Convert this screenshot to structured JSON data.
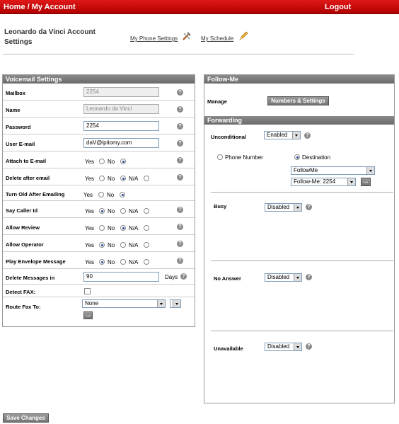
{
  "topbar": {
    "home": "Home / My Account",
    "logout": "Logout"
  },
  "header": {
    "title": "Leonardo da Vinci Account Settings",
    "phone_link": "My Phone Settings",
    "schedule_link": "My Schedule"
  },
  "voicemail": {
    "title": "Voicemail Settings",
    "mailbox": {
      "label": "Mailbox",
      "value": "2254"
    },
    "name": {
      "label": "Name",
      "value": "Leonardo da Vinci"
    },
    "password": {
      "label": "Password",
      "value": "2254"
    },
    "email": {
      "label": "User E-mail",
      "value": "daV@ipitomy.com"
    },
    "attach": {
      "label": "Attach to E-mail"
    },
    "delete_after": {
      "label": "Delete after email"
    },
    "turn_old": {
      "label": "Turn Old After Emailing"
    },
    "caller_id": {
      "label": "Say Caller Id"
    },
    "review": {
      "label": "Allow Review"
    },
    "operator": {
      "label": "Allow Operator"
    },
    "envelope": {
      "label": "Play Envelope Message"
    },
    "delete_msgs": {
      "label": "Delete Messages in",
      "value": "90",
      "unit": "Days"
    },
    "detect_fax": {
      "label": "Detect FAX:"
    },
    "route_fax": {
      "label": "Route Fax To:",
      "value": "None"
    },
    "opt_yes": "Yes",
    "opt_no": "No",
    "opt_na": "N/A"
  },
  "followme": {
    "title": "Follow-Me",
    "manage": "Manage",
    "button": "Numbers & Settings"
  },
  "forwarding": {
    "title": "Forwarding",
    "unconditional": {
      "label": "Unconditional",
      "value": "Enabled"
    },
    "phone_number": "Phone Number",
    "destination": "Destination",
    "dest_select": "FollowMe",
    "dest_sub": "Follow-Me: 2254",
    "busy": {
      "label": "Busy",
      "value": "Disabled"
    },
    "noanswer": {
      "label": "No Answer",
      "value": "Disabled"
    },
    "unavailable": {
      "label": "Unavailable",
      "value": "Disabled"
    }
  },
  "footer": {
    "save": "Save Changes"
  },
  "misc": {
    "help": "?",
    "ellipsis": "..."
  }
}
